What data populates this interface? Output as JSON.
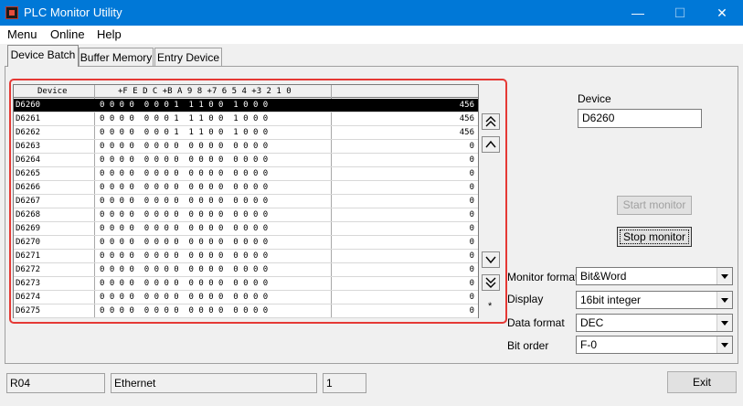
{
  "window": {
    "title": "PLC Monitor Utility",
    "minimize": "—",
    "maximize": "☐",
    "close": "✕"
  },
  "menu": [
    {
      "label": "Menu"
    },
    {
      "label": "Online"
    },
    {
      "label": "Help"
    }
  ],
  "tabs": [
    {
      "label": "Device Batch"
    },
    {
      "label": "Buffer Memory"
    },
    {
      "label": "Entry Device"
    }
  ],
  "grid": {
    "headers": {
      "device": "Device",
      "bits": "+F E D C +B A 9 8 +7 6 5 4 +3 2 1 0"
    },
    "rows": [
      {
        "device": "D6260",
        "bits": "0 0 0 0  0 0 0 1  1 1 0 0  1 0 0 0",
        "value": "456"
      },
      {
        "device": "D6261",
        "bits": "0 0 0 0  0 0 0 1  1 1 0 0  1 0 0 0",
        "value": "456"
      },
      {
        "device": "D6262",
        "bits": "0 0 0 0  0 0 0 1  1 1 0 0  1 0 0 0",
        "value": "456"
      },
      {
        "device": "D6263",
        "bits": "0 0 0 0  0 0 0 0  0 0 0 0  0 0 0 0",
        "value": "0"
      },
      {
        "device": "D6264",
        "bits": "0 0 0 0  0 0 0 0  0 0 0 0  0 0 0 0",
        "value": "0"
      },
      {
        "device": "D6265",
        "bits": "0 0 0 0  0 0 0 0  0 0 0 0  0 0 0 0",
        "value": "0"
      },
      {
        "device": "D6266",
        "bits": "0 0 0 0  0 0 0 0  0 0 0 0  0 0 0 0",
        "value": "0"
      },
      {
        "device": "D6267",
        "bits": "0 0 0 0  0 0 0 0  0 0 0 0  0 0 0 0",
        "value": "0"
      },
      {
        "device": "D6268",
        "bits": "0 0 0 0  0 0 0 0  0 0 0 0  0 0 0 0",
        "value": "0"
      },
      {
        "device": "D6269",
        "bits": "0 0 0 0  0 0 0 0  0 0 0 0  0 0 0 0",
        "value": "0"
      },
      {
        "device": "D6270",
        "bits": "0 0 0 0  0 0 0 0  0 0 0 0  0 0 0 0",
        "value": "0"
      },
      {
        "device": "D6271",
        "bits": "0 0 0 0  0 0 0 0  0 0 0 0  0 0 0 0",
        "value": "0"
      },
      {
        "device": "D6272",
        "bits": "0 0 0 0  0 0 0 0  0 0 0 0  0 0 0 0",
        "value": "0"
      },
      {
        "device": "D6273",
        "bits": "0 0 0 0  0 0 0 0  0 0 0 0  0 0 0 0",
        "value": "0"
      },
      {
        "device": "D6274",
        "bits": "0 0 0 0  0 0 0 0  0 0 0 0  0 0 0 0",
        "value": "0"
      },
      {
        "device": "D6275",
        "bits": "0 0 0 0  0 0 0 0  0 0 0 0  0 0 0 0",
        "value": "0"
      }
    ],
    "marker": "*"
  },
  "device_panel": {
    "label": "Device",
    "value": "D6260"
  },
  "buttons": {
    "start": "Start monitor",
    "stop": "Stop monitor",
    "exit": "Exit"
  },
  "settings": [
    {
      "label": "Monitor format",
      "value": "Bit&Word"
    },
    {
      "label": "Display",
      "value": "16bit integer"
    },
    {
      "label": "Data format",
      "value": "DEC"
    },
    {
      "label": "Bit order",
      "value": "F-0"
    }
  ],
  "status": {
    "cpu": "R04",
    "connection": "Ethernet",
    "station": "1"
  },
  "colors": {
    "titlebar": "#0078d7",
    "highlight_frame": "#e53935",
    "selected_row": "#000000"
  }
}
